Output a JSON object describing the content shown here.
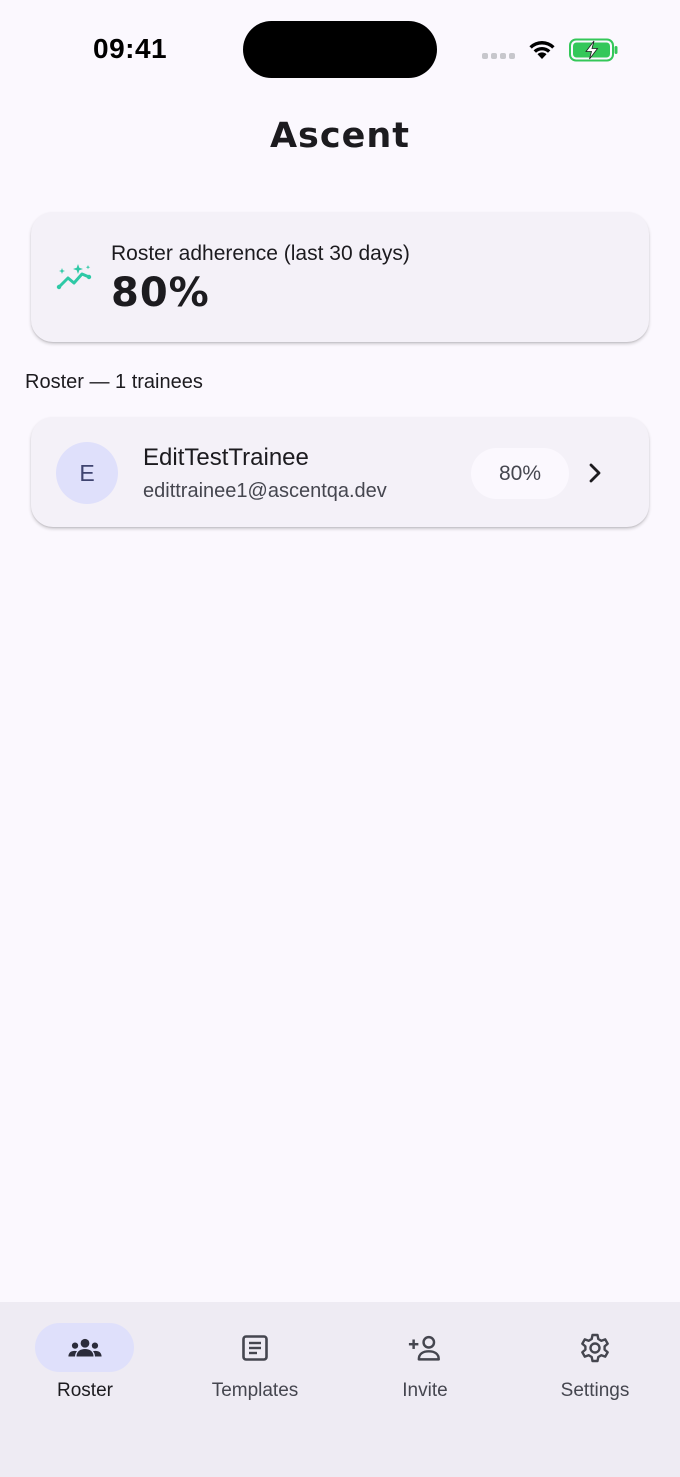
{
  "status_bar": {
    "time": "09:41"
  },
  "header": {
    "title": "Ascent"
  },
  "adherence_card": {
    "label": "Roster adherence (last 30 days)",
    "value": "80%",
    "icon": "trend-sparkle-icon",
    "accent_color": "#2ec9a6"
  },
  "roster": {
    "section_label": "Roster — 1 trainees",
    "trainees": [
      {
        "initial": "E",
        "name": "EditTestTrainee",
        "email": "edittrainee1@ascentqa.dev",
        "adherence": "80%"
      }
    ]
  },
  "bottom_nav": {
    "items": [
      {
        "label": "Roster",
        "icon": "group-icon",
        "active": true
      },
      {
        "label": "Templates",
        "icon": "document-icon",
        "active": false
      },
      {
        "label": "Invite",
        "icon": "add-person-icon",
        "active": false
      },
      {
        "label": "Settings",
        "icon": "gear-icon",
        "active": false
      }
    ]
  },
  "colors": {
    "background": "#fbf8fe",
    "card": "#f4f1f8",
    "active_indicator": "#dfe0fb",
    "battery_green": "#34c759"
  }
}
